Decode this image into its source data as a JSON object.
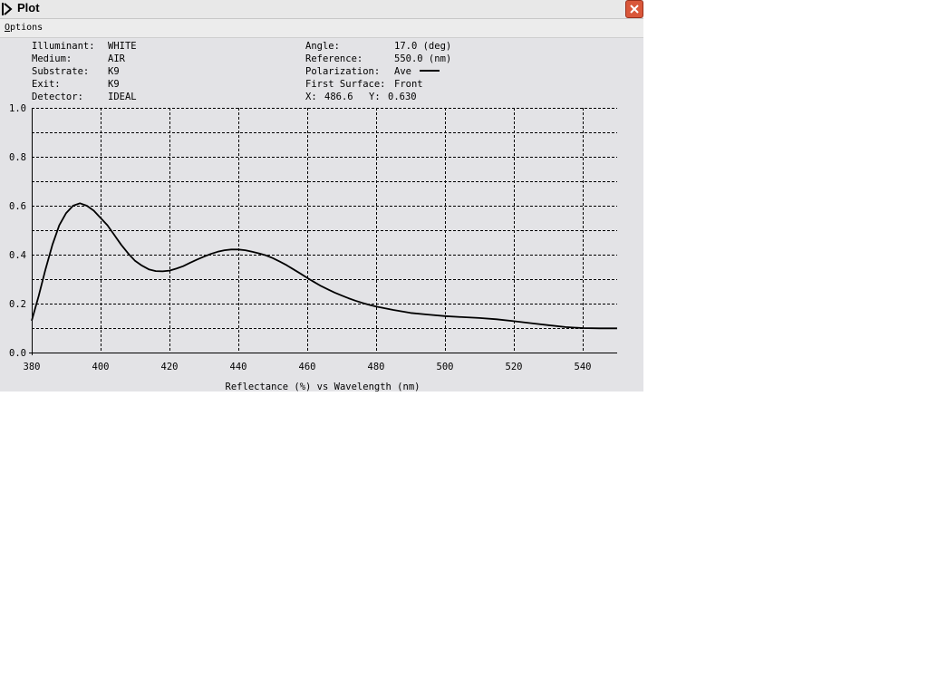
{
  "window": {
    "title": "Plot",
    "menu": [
      {
        "label": "Options",
        "accel": "O",
        "rest": "ptions"
      }
    ]
  },
  "info": {
    "illuminant": {
      "label": "Illuminant:",
      "value": "WHITE"
    },
    "medium": {
      "label": "Medium:",
      "value": "AIR"
    },
    "substrate": {
      "label": "Substrate:",
      "value": "K9"
    },
    "exit": {
      "label": "Exit:",
      "value": "K9"
    },
    "detector": {
      "label": "Detector:",
      "value": "IDEAL"
    },
    "angle": {
      "label": "Angle:",
      "value": "17.0 (deg)"
    },
    "reference": {
      "label": "Reference:",
      "value": "550.0 (nm)"
    },
    "polarization": {
      "label": "Polarization:",
      "value": "Ave"
    },
    "first_surface": {
      "label": "First Surface:",
      "value": "Front"
    },
    "cursor_readout": {
      "x_label": "X:",
      "x_value": "486.6",
      "y_label": "Y:",
      "y_value": "0.630"
    }
  },
  "chart_data": {
    "type": "line",
    "xlabel": "Reflectance (%)  vs  Wavelength (nm)",
    "ylabel": "",
    "xlim": [
      380,
      550
    ],
    "ylim": [
      0.0,
      1.0
    ],
    "x_ticks": [
      380,
      400,
      420,
      440,
      460,
      480,
      500,
      520,
      540
    ],
    "y_ticks": [
      0.0,
      0.2,
      0.4,
      0.6,
      0.8,
      1.0
    ],
    "grid": true,
    "series": [
      {
        "color": "#000000",
        "x": [
          380,
          382,
          384,
          386,
          388,
          390,
          392,
          394,
          396,
          398,
          400,
          402,
          404,
          406,
          408,
          410,
          412,
          414,
          416,
          418,
          420,
          422,
          424,
          426,
          428,
          430,
          432,
          434,
          436,
          438,
          440,
          442,
          444,
          446,
          448,
          450,
          452,
          454,
          456,
          458,
          460,
          462,
          464,
          466,
          468,
          470,
          472,
          474,
          476,
          478,
          480,
          485,
          490,
          495,
          500,
          505,
          510,
          515,
          520,
          525,
          530,
          535,
          540,
          545,
          550
        ],
        "y": [
          0.13,
          0.23,
          0.34,
          0.44,
          0.52,
          0.57,
          0.6,
          0.61,
          0.6,
          0.58,
          0.55,
          0.52,
          0.48,
          0.44,
          0.405,
          0.375,
          0.355,
          0.34,
          0.333,
          0.332,
          0.335,
          0.343,
          0.353,
          0.367,
          0.38,
          0.392,
          0.403,
          0.412,
          0.418,
          0.421,
          0.421,
          0.418,
          0.412,
          0.405,
          0.397,
          0.386,
          0.372,
          0.357,
          0.34,
          0.323,
          0.305,
          0.288,
          0.272,
          0.258,
          0.245,
          0.233,
          0.222,
          0.212,
          0.203,
          0.195,
          0.188,
          0.174,
          0.162,
          0.155,
          0.149,
          0.145,
          0.141,
          0.136,
          0.128,
          0.12,
          0.112,
          0.104,
          0.1,
          0.099,
          0.099
        ]
      }
    ]
  }
}
